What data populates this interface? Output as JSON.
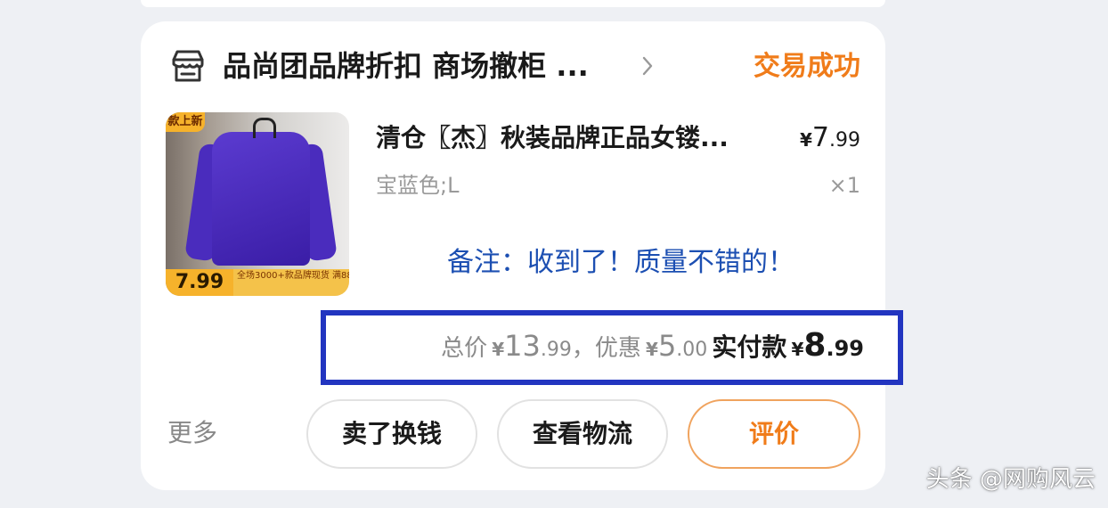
{
  "order": {
    "shop_name": "品尚团品牌折扣 商场撤柜 ...",
    "status": "交易成功",
    "item": {
      "title": "清仓〖杰〗秋装品牌正品女镂...",
      "price_symbol": "¥",
      "price_int": "7",
      "price_dec": ".99",
      "spec": "宝蓝色;L",
      "quantity": "×1",
      "thumbnail": {
        "badge": "款上新",
        "price_tag": "7.99",
        "promo_text": "全场3000+款品牌现货 满88元包邮 满200-10"
      }
    },
    "note": "备注：收到了！质量不错的！",
    "summary": {
      "total_label": "总价",
      "total_int": "13",
      "total_dec": ".99",
      "separator": "，",
      "discount_label": "优惠",
      "discount_int": "5",
      "discount_dec": ".00",
      "paid_label": "实付款",
      "paid_int": "8",
      "paid_dec": ".99",
      "currency": "¥"
    },
    "actions": {
      "more": "更多",
      "sell": "卖了换钱",
      "logistics": "查看物流",
      "review": "评价"
    }
  },
  "watermark": "头条 @网购风云",
  "colors": {
    "status_orange": "#f07c1a",
    "note_blue": "#1c4fb2",
    "highlight_box": "#2235c0"
  },
  "icons": {
    "shop": "store-icon",
    "chevron": "chevron-right-icon"
  }
}
